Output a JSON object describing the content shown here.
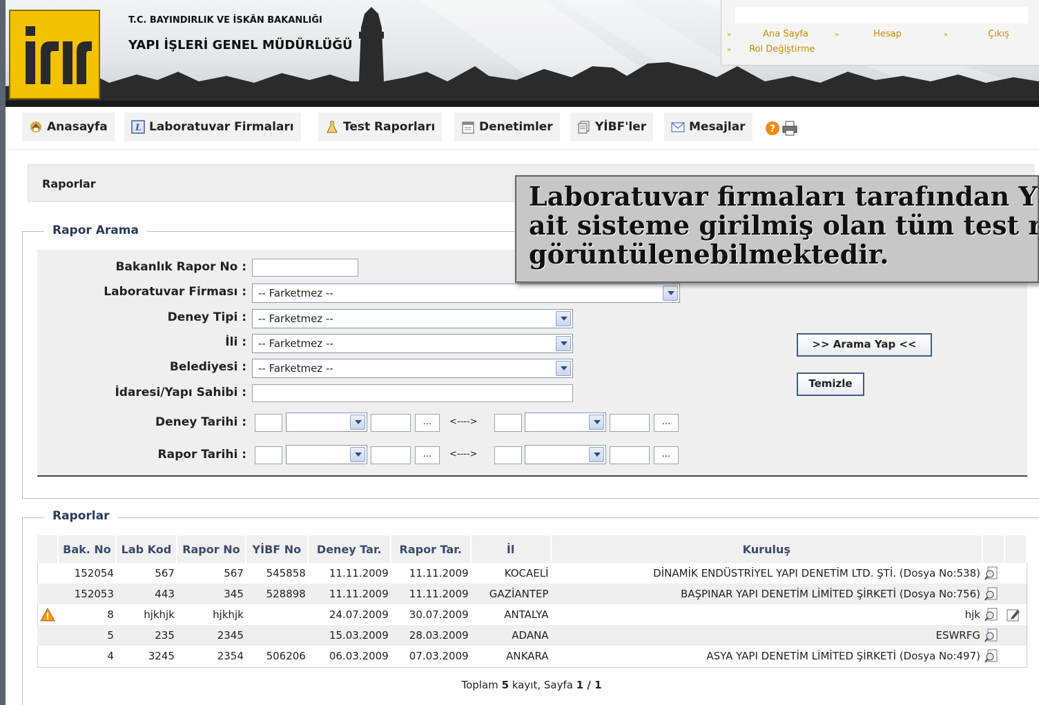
{
  "header": {
    "logo_text": "YİR",
    "ministry": "T.C. BAYINDIRLIK VE İSKÂN BAKANLIĞI",
    "directorate": "YAPI İŞLERİ GENEL MÜDÜRLÜĞÜ"
  },
  "top_links": {
    "home": "Ana Sayfa",
    "account": "Hesap",
    "logout": "Çıkış",
    "change_role": "Rol Değiştirme"
  },
  "nav": {
    "home": "Anasayfa",
    "labs": "Laboratuvar Firmaları",
    "test_reports": "Test Raporları",
    "inspections": "Denetimler",
    "yibf": "YİBF'ler",
    "messages": "Mesajlar"
  },
  "page_title": "Raporlar",
  "search": {
    "legend": "Rapor Arama",
    "labels": {
      "report_no": "Bakanlık Rapor No :",
      "lab_firm": "Laboratuvar Firması :",
      "test_type": "Deney Tipi :",
      "city": "İli :",
      "municipality": "Belediyesi :",
      "owner": "İdaresi/Yapı Sahibi :",
      "test_date": "Deney Tarihi :",
      "report_date": "Rapor Tarihi :"
    },
    "report_no_value": "",
    "owner_value": "",
    "lab_firm_selected": "-- Farketmez --",
    "test_type_selected": "-- Farketmez --",
    "city_selected": "-- Farketmez --",
    "municipality_selected": "-- Farketmez --",
    "dots": "...",
    "range_arrow": "<---->",
    "search_button": ">> Arama Yap <<",
    "clear_button": "Temizle"
  },
  "tooltip": {
    "line1": "Laboratuvar firmaları tarafından Y",
    "line2": "ait sisteme girilmiş olan tüm test rap",
    "line3": "görüntülenebilmektedir."
  },
  "results": {
    "legend": "Raporlar",
    "columns": [
      "Bak. No",
      "Lab Kod",
      "Rapor No",
      "YİBF No",
      "Deney Tar.",
      "Rapor Tar.",
      "İl",
      "Kuruluş"
    ],
    "rows": [
      {
        "bak_no": "152054",
        "lab_kod": "567",
        "rapor_no": "567",
        "yibf_no": "545858",
        "deney_tar": "11.11.2009",
        "rapor_tar": "11.11.2009",
        "il": "KOCAELİ",
        "kurulus": "DİNAMİK ENDÜSTRİYEL YAPI DENETİM LTD. ŞTİ. (Dosya No:538)"
      },
      {
        "bak_no": "152053",
        "lab_kod": "443",
        "rapor_no": "345",
        "yibf_no": "528898",
        "deney_tar": "11.11.2009",
        "rapor_tar": "11.11.2009",
        "il": "GAZİANTEP",
        "kurulus": "BAŞPINAR YAPI DENETİM LİMİTED ŞİRKETİ (Dosya No:756)"
      },
      {
        "bak_no": "8",
        "lab_kod": "hjkhjk",
        "rapor_no": "hjkhjk",
        "yibf_no": "",
        "deney_tar": "24.07.2009",
        "rapor_tar": "30.07.2009",
        "il": "ANTALYA",
        "kurulus": "hjk"
      },
      {
        "bak_no": "5",
        "lab_kod": "235",
        "rapor_no": "2345",
        "yibf_no": "",
        "deney_tar": "15.03.2009",
        "rapor_tar": "28.03.2009",
        "il": "ADANA",
        "kurulus": "ESWRFG"
      },
      {
        "bak_no": "4",
        "lab_kod": "3245",
        "rapor_no": "2354",
        "yibf_no": "506206",
        "deney_tar": "06.03.2009",
        "rapor_tar": "07.03.2009",
        "il": "ANKARA",
        "kurulus": "ASYA YAPI DENETİM LİMİTED ŞİRKETİ (Dosya No:497)"
      }
    ],
    "paging": {
      "prefix": "Toplam",
      "total": "5",
      "middle": "kayıt, Sayfa",
      "page": "1 / 1"
    }
  },
  "colors": {
    "logo_yellow": "#f3c200",
    "link_orange": "#c98a00",
    "legend_blue": "#2a3a5a"
  }
}
